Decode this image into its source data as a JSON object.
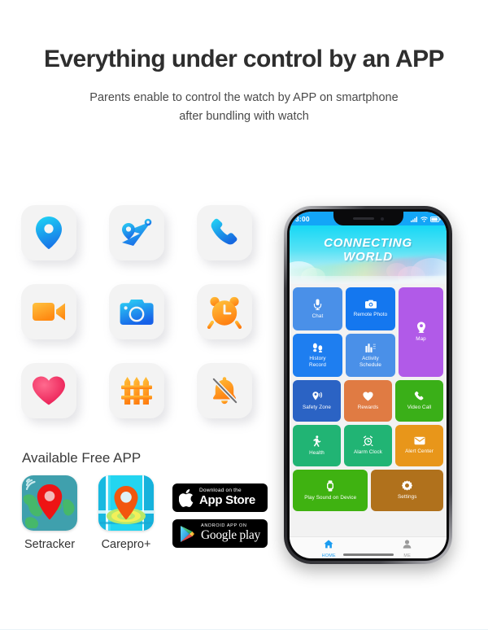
{
  "header": {
    "title": "Everything under control by an APP",
    "subtitle_line1": "Parents enable to control the watch by APP on smartphone",
    "subtitle_line2": "after bundling with watch"
  },
  "feature_icons": [
    {
      "name": "location-pin-icon",
      "label": "Location"
    },
    {
      "name": "route-map-icon",
      "label": "Route Tracking"
    },
    {
      "name": "phone-call-icon",
      "label": "Phone Call"
    },
    {
      "name": "video-camera-icon",
      "label": "Video"
    },
    {
      "name": "photo-camera-icon",
      "label": "Camera"
    },
    {
      "name": "alarm-clock-icon",
      "label": "Alarm"
    },
    {
      "name": "heart-icon",
      "label": "Health"
    },
    {
      "name": "fence-icon",
      "label": "Safety Fence"
    },
    {
      "name": "bell-off-icon",
      "label": "Silent Mode"
    }
  ],
  "free_app": {
    "title": "Available Free APP",
    "apps": [
      {
        "label": "Setracker",
        "icon": "setracker-app-icon"
      },
      {
        "label": "Carepro+",
        "icon": "carepro-app-icon"
      }
    ],
    "badges": [
      {
        "name": "app-store-badge",
        "small": "Download on the",
        "big": "App Store"
      },
      {
        "name": "google-play-badge",
        "small": "ANDROID APP ON",
        "big": "Google play"
      }
    ]
  },
  "phone": {
    "status_bar": {
      "time": "3:00",
      "icons": [
        "signal-icon",
        "wifi-icon",
        "battery-icon"
      ]
    },
    "app_banner": {
      "line1": "CONNECTING",
      "line2": "WORLD"
    },
    "tiles": [
      {
        "label": "Chat",
        "icon": "microphone-icon",
        "color": "#4a90e8"
      },
      {
        "label": "Remote Photo",
        "icon": "camera-icon",
        "color": "#1477ef"
      },
      {
        "label": "Map",
        "icon": "map-pin-icon",
        "color": "#b15ae8"
      },
      {
        "label": "History\nRecord",
        "icon": "footprints-icon",
        "color": "#1e7ef0"
      },
      {
        "label": "Activity\nSchedule",
        "icon": "bar-chart-icon",
        "color": "#4a90e8"
      },
      {
        "label": "Safety Zone",
        "icon": "safety-zone-icon",
        "color": "#2b63c4"
      },
      {
        "label": "Rewards",
        "icon": "heart-icon",
        "color": "#e07b43"
      },
      {
        "label": "Video Call",
        "icon": "phone-icon",
        "color": "#3aaf18"
      },
      {
        "label": "Health",
        "icon": "walking-icon",
        "color": "#21b474"
      },
      {
        "label": "Alarm Clock",
        "icon": "alarm-icon",
        "color": "#21b474"
      },
      {
        "label": "Alert Center",
        "icon": "envelope-icon",
        "color": "#e8961a"
      },
      {
        "label": "Play Sound on Device",
        "icon": "watch-icon",
        "color": "#3fb211"
      },
      {
        "label": "Settings",
        "icon": "gear-icon",
        "color": "#b0711c"
      }
    ],
    "tabs": [
      {
        "label": "HOME",
        "icon": "home-icon",
        "active": true
      },
      {
        "label": "ME",
        "icon": "person-icon",
        "active": false
      }
    ]
  },
  "colors": {
    "headline": "#2e2e2e",
    "status_bar": "#13a5f7",
    "banner_top": "#17d8f5",
    "tab_active": "#1a9cf0",
    "tile_background": "#f2f2f2"
  }
}
